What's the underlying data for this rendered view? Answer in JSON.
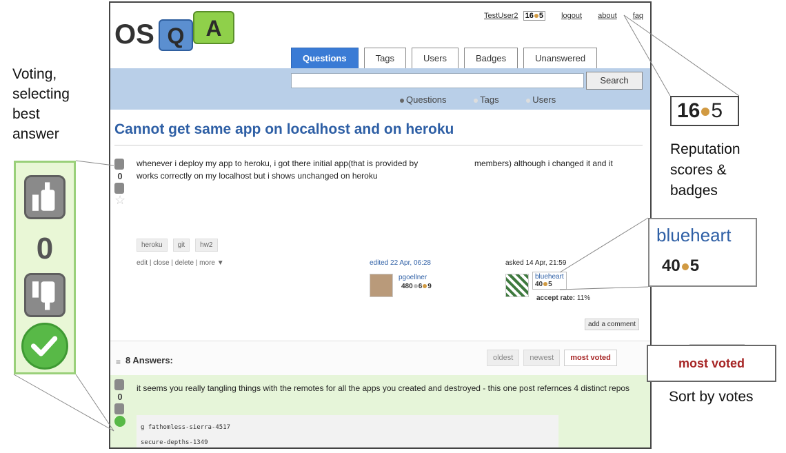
{
  "annotations": {
    "left_lines": [
      "Voting,",
      "selecting",
      "best",
      "answer"
    ],
    "reputation_lines": [
      "Reputation",
      "scores &",
      "badges"
    ],
    "sort_label": "Sort by votes"
  },
  "zoom": {
    "vote_count": "0",
    "rep_score": "16",
    "rep_badges": "5",
    "user_name": "blueheart",
    "user_score": "40",
    "user_badges": "5",
    "sort_tab": "most voted"
  },
  "logo": {
    "os": "OS",
    "q": "Q",
    "a": "A"
  },
  "userbar": {
    "username": "TestUser2",
    "score": "16",
    "badges": "5",
    "logout": "logout",
    "about": "about",
    "faq": "faq"
  },
  "tabs": [
    "Questions",
    "Tags",
    "Users",
    "Badges",
    "Unanswered"
  ],
  "search": {
    "button": "Search",
    "placeholder": ""
  },
  "scopes": [
    "Questions",
    "Tags",
    "Users"
  ],
  "question": {
    "title": "Cannot get same app on localhost and on heroku",
    "votes": "0",
    "body_part1": "whenever i deploy my app to heroku, i got there initial app(that is provided by",
    "body_part2": "members) although i changed it and it",
    "body_line2": "works correctly on my localhost but i shows unchanged on heroku",
    "tags": [
      "heroku",
      "git",
      "hw2"
    ],
    "actions": "edit | close | delete | more ▼",
    "edited": "edited 22 Apr, 06:28",
    "editor_name": "pgoellner",
    "editor_rep": "480",
    "editor_badges1": "6",
    "editor_badges2": "9",
    "asked": "asked 14 Apr, 21:59",
    "asker_name": "blueheart",
    "asker_rep": "40",
    "asker_badges": "5",
    "accept_label": "accept rate:",
    "accept_value": "11%",
    "add_comment": "add a comment"
  },
  "answers": {
    "count_label": "8 Answers:",
    "sort_tabs": [
      "oldest",
      "newest",
      "most voted"
    ],
    "first": {
      "votes": "0",
      "text": "it seems you really tangling things with the remotes for all the apps you created and destroyed - this one post refernces 4 distinct repos",
      "code_lines": [
        "g fathomless-sierra-4517",
        "secure-depths-1349"
      ]
    }
  },
  "colors": {
    "accent": "#3a7bd5",
    "title": "#2e5fa5",
    "sort_active": "#a62424",
    "answer_bg": "#e6f5d9",
    "badge_bronze": "#d19a42"
  }
}
